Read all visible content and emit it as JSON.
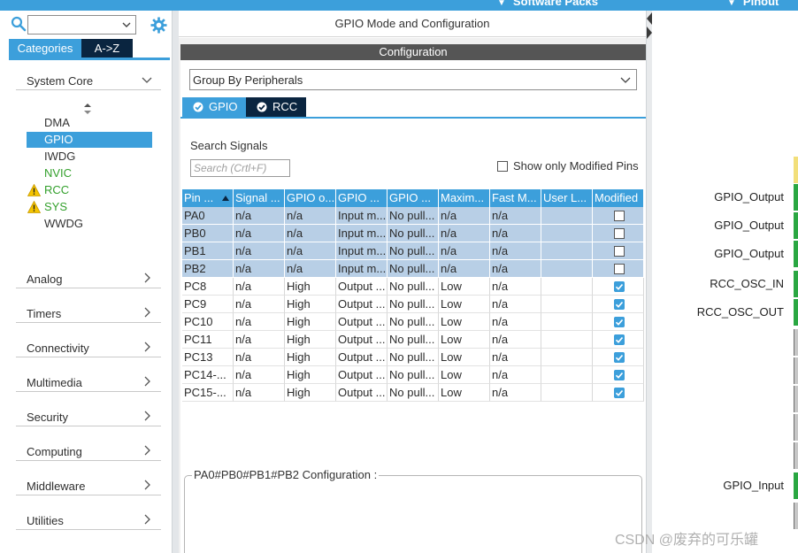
{
  "topbar": {
    "software_packs": "Software Packs",
    "pinout": "Pinout"
  },
  "left": {
    "search_value": "",
    "tabs": {
      "categories": "Categories",
      "az": "A->Z"
    },
    "system_core": {
      "label": "System Core",
      "items": [
        {
          "label": "DMA",
          "state": "normal"
        },
        {
          "label": "GPIO",
          "state": "selected"
        },
        {
          "label": "IWDG",
          "state": "normal"
        },
        {
          "label": "NVIC",
          "state": "enabled"
        },
        {
          "label": "RCC",
          "state": "warning"
        },
        {
          "label": "SYS",
          "state": "warning"
        },
        {
          "label": "WWDG",
          "state": "normal"
        }
      ]
    },
    "categories": [
      "Analog",
      "Timers",
      "Connectivity",
      "Multimedia",
      "Security",
      "Computing",
      "Middleware",
      "Utilities"
    ]
  },
  "mid": {
    "header": "GPIO Mode and Configuration",
    "config_label": "Configuration",
    "group_by": "Group By Peripherals",
    "tabs": {
      "gpio": "GPIO",
      "rcc": "RCC"
    },
    "search_signals_label": "Search Signals",
    "search_placeholder": "Search (Crtl+F)",
    "show_modified_label": "Show only Modified Pins",
    "columns": [
      "Pin ...",
      "Signal ...",
      "GPIO o...",
      "GPIO ...",
      "GPIO ...",
      "Maxim...",
      "Fast M...",
      "User L...",
      "Modified"
    ],
    "rows": [
      {
        "pin": "PA0",
        "signal": "n/a",
        "output": "n/a",
        "mode": "Input m...",
        "pull": "No pull...",
        "speed": "n/a",
        "fast": "n/a",
        "user": "",
        "modified": false,
        "selected": true
      },
      {
        "pin": "PB0",
        "signal": "n/a",
        "output": "n/a",
        "mode": "Input m...",
        "pull": "No pull...",
        "speed": "n/a",
        "fast": "n/a",
        "user": "",
        "modified": false,
        "selected": true
      },
      {
        "pin": "PB1",
        "signal": "n/a",
        "output": "n/a",
        "mode": "Input m...",
        "pull": "No pull...",
        "speed": "n/a",
        "fast": "n/a",
        "user": "",
        "modified": false,
        "selected": true
      },
      {
        "pin": "PB2",
        "signal": "n/a",
        "output": "n/a",
        "mode": "Input m...",
        "pull": "No pull...",
        "speed": "n/a",
        "fast": "n/a",
        "user": "",
        "modified": false,
        "selected": true
      },
      {
        "pin": "PC8",
        "signal": "n/a",
        "output": "High",
        "mode": "Output ...",
        "pull": "No pull...",
        "speed": "Low",
        "fast": "n/a",
        "user": "",
        "modified": true,
        "selected": false
      },
      {
        "pin": "PC9",
        "signal": "n/a",
        "output": "High",
        "mode": "Output ...",
        "pull": "No pull...",
        "speed": "Low",
        "fast": "n/a",
        "user": "",
        "modified": true,
        "selected": false
      },
      {
        "pin": "PC10",
        "signal": "n/a",
        "output": "High",
        "mode": "Output ...",
        "pull": "No pull...",
        "speed": "Low",
        "fast": "n/a",
        "user": "",
        "modified": true,
        "selected": false
      },
      {
        "pin": "PC11",
        "signal": "n/a",
        "output": "High",
        "mode": "Output ...",
        "pull": "No pull...",
        "speed": "Low",
        "fast": "n/a",
        "user": "",
        "modified": true,
        "selected": false
      },
      {
        "pin": "PC13",
        "signal": "n/a",
        "output": "High",
        "mode": "Output ...",
        "pull": "No pull...",
        "speed": "Low",
        "fast": "n/a",
        "user": "",
        "modified": true,
        "selected": false
      },
      {
        "pin": "PC14-...",
        "signal": "n/a",
        "output": "High",
        "mode": "Output ...",
        "pull": "No pull...",
        "speed": "Low",
        "fast": "n/a",
        "user": "",
        "modified": true,
        "selected": false
      },
      {
        "pin": "PC15-...",
        "signal": "n/a",
        "output": "High",
        "mode": "Output ...",
        "pull": "No pull...",
        "speed": "Low",
        "fast": "n/a",
        "user": "",
        "modified": true,
        "selected": false
      }
    ],
    "pin_config_title": "PA0#PB0#PB1#PB2 Configuration :"
  },
  "right": {
    "pins": [
      {
        "label": "",
        "color": "yellow"
      },
      {
        "label": "GPIO_Output",
        "color": "green"
      },
      {
        "label": "GPIO_Output",
        "color": "green"
      },
      {
        "label": "GPIO_Output",
        "color": "green"
      },
      {
        "label": "RCC_OSC_IN",
        "color": "green"
      },
      {
        "label": "RCC_OSC_OUT",
        "color": "green"
      },
      {
        "label": "",
        "color": "gray"
      },
      {
        "label": "",
        "color": "gray"
      },
      {
        "label": "",
        "color": "gray"
      },
      {
        "label": "",
        "color": "gray"
      },
      {
        "label": "",
        "color": "gray"
      },
      {
        "label": "GPIO_Input",
        "color": "green"
      },
      {
        "label": "",
        "color": "gray"
      }
    ]
  },
  "watermark": "CSDN @废弃的可乐罐",
  "colors": {
    "accent": "#3c9fdb",
    "dark_tab": "#0a2540",
    "enabled_text": "#33a02c",
    "pin_green": "#2aa742",
    "selection": "#b8cfe6"
  },
  "icons": [
    "search-icon",
    "gear-icon",
    "chevron-down-icon",
    "chevron-right-icon",
    "warning-icon",
    "check-icon",
    "sort-arrows-icon"
  ]
}
